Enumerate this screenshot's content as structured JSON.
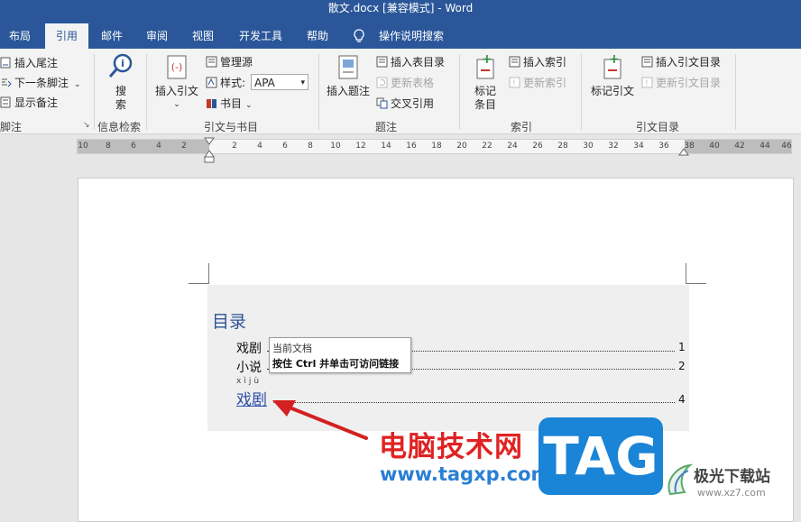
{
  "window": {
    "title": "散文.docx [兼容模式]  -  Word"
  },
  "tabs": [
    {
      "label": "布局"
    },
    {
      "label": "引用"
    },
    {
      "label": "邮件"
    },
    {
      "label": "审阅"
    },
    {
      "label": "视图"
    },
    {
      "label": "开发工具"
    },
    {
      "label": "帮助"
    },
    {
      "label": "操作说明搜索"
    }
  ],
  "ribbon": {
    "footnotes": {
      "insert_endnote": "插入尾注",
      "next_footnote": "下一条脚注",
      "show_notes": "显示备注",
      "label": "脚注"
    },
    "research": {
      "search": "搜",
      "search2": "索",
      "label": "信息检索"
    },
    "citations": {
      "insert_citation": "插入引文",
      "manage_sources": "管理源",
      "style_label": "样式:",
      "style_value": "APA",
      "bibliography": "书目",
      "label": "引文与书目"
    },
    "captions": {
      "insert_caption": "插入题注",
      "insert_table_of_figures": "插入表目录",
      "update_table": "更新表格",
      "cross_reference": "交叉引用",
      "label": "题注"
    },
    "index": {
      "mark_entry": "标记",
      "mark_entry2": "条目",
      "insert_index": "插入索引",
      "update_index": "更新索引",
      "label": "索引"
    },
    "authorities": {
      "mark_citation": "标记引文",
      "insert_toa": "插入引文目录",
      "update_toa": "更新引文目录",
      "label": "引文目录"
    }
  },
  "ruler": {
    "left_ticks": [
      "10",
      "8",
      "6",
      "4",
      "2"
    ],
    "right_ticks": [
      "2",
      "4",
      "6",
      "8",
      "10",
      "12",
      "14",
      "16",
      "18",
      "20",
      "22",
      "24",
      "26",
      "28",
      "30",
      "32",
      "34",
      "36",
      "38",
      "40",
      "42",
      "44",
      "46"
    ]
  },
  "document": {
    "toc_title": "目录",
    "entries": [
      {
        "text": "戏剧",
        "page": "1"
      },
      {
        "text": "小说",
        "page": "2"
      },
      {
        "text": "戏剧",
        "ruby": "xìjù",
        "page": "4"
      }
    ]
  },
  "tooltip": {
    "line1": "当前文档",
    "line2": "按住 Ctrl 并单击可访问链接"
  },
  "watermark": {
    "cn": "电脑技术网",
    "url": "www.tagxp.com",
    "tag": "TAG",
    "site_cn": "极光下载站",
    "site_url": "www.xz7.com"
  },
  "colors": {
    "accent": "#2b579a",
    "toc_heading": "#2e5496",
    "link": "#2f4fa8",
    "arrow": "#d42020"
  }
}
